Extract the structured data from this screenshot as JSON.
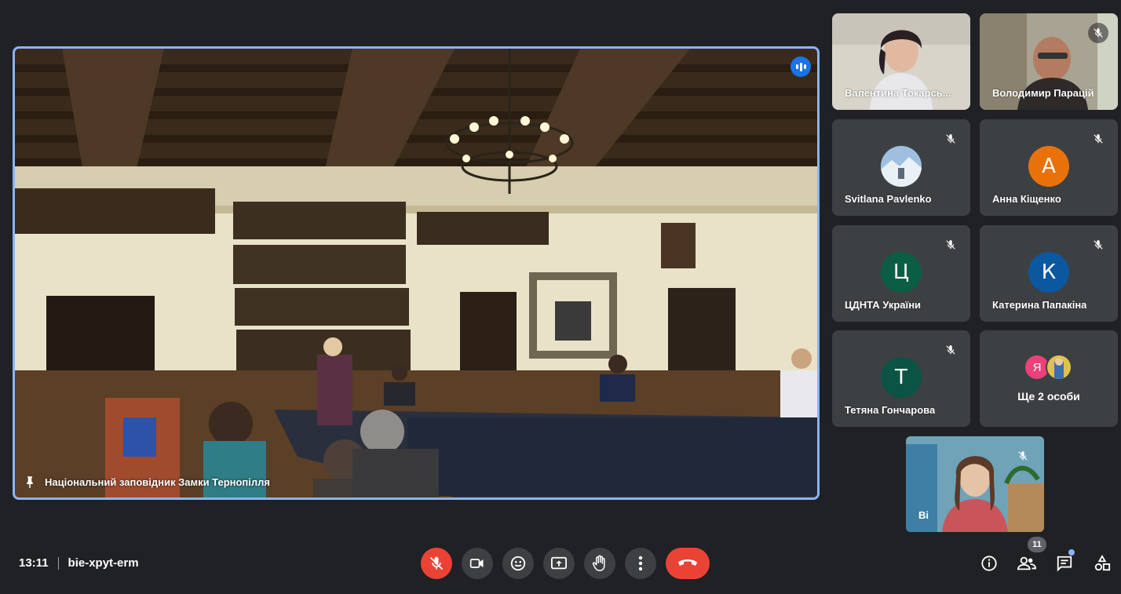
{
  "main": {
    "pinned_name": "Національний заповідник Замки Тернопілля"
  },
  "participants": [
    {
      "name": "Валентина Токарська",
      "display": "Валентина Токарсь...",
      "type": "video",
      "muted": false
    },
    {
      "name": "Володимир Парацій",
      "display": "Володимир Парацій",
      "type": "video",
      "muted": true
    },
    {
      "name": "Svitlana Pavlenko",
      "display": "Svitlana Pavlenko",
      "type": "photo",
      "muted": true
    },
    {
      "name": "Анна Кіщенко",
      "display": "Анна Кіщенко",
      "type": "letter",
      "initial": "А",
      "color": "#e8710a",
      "muted": true
    },
    {
      "name": "ЦДНТА України",
      "display": "ЦДНТА України",
      "type": "letter",
      "initial": "Ц",
      "color": "#0b5e44",
      "muted": true
    },
    {
      "name": "Катерина Папакіна",
      "display": "Катерина Папакіна",
      "type": "letter",
      "initial": "К",
      "color": "#0b57a0",
      "muted": true
    },
    {
      "name": "Тетяна Гончарова",
      "display": "Тетяна Гончарова",
      "type": "letter",
      "initial": "Т",
      "color": "#0b5345",
      "muted": true
    }
  ],
  "more": {
    "label": "Ще 2 особи",
    "initial": "Я"
  },
  "self_view": {
    "name": "Ві"
  },
  "bottom_bar": {
    "time": "13:11",
    "meeting_code": "bie-xpyt-erm",
    "participant_count": "11"
  },
  "icons": {
    "mic_off": "mic-off-icon",
    "camera": "camera-icon",
    "emoji": "emoji-icon",
    "present": "present-screen-icon",
    "hand": "raise-hand-icon",
    "more": "more-options-icon",
    "hangup": "hangup-icon",
    "info": "info-icon",
    "people": "people-icon",
    "chat": "chat-icon",
    "activities": "activities-icon",
    "pin": "pin-icon"
  },
  "colors": {
    "accent": "#8ab4f8",
    "danger": "#ea4335",
    "tile_bg": "#3c4043",
    "page_bg": "#202124"
  }
}
